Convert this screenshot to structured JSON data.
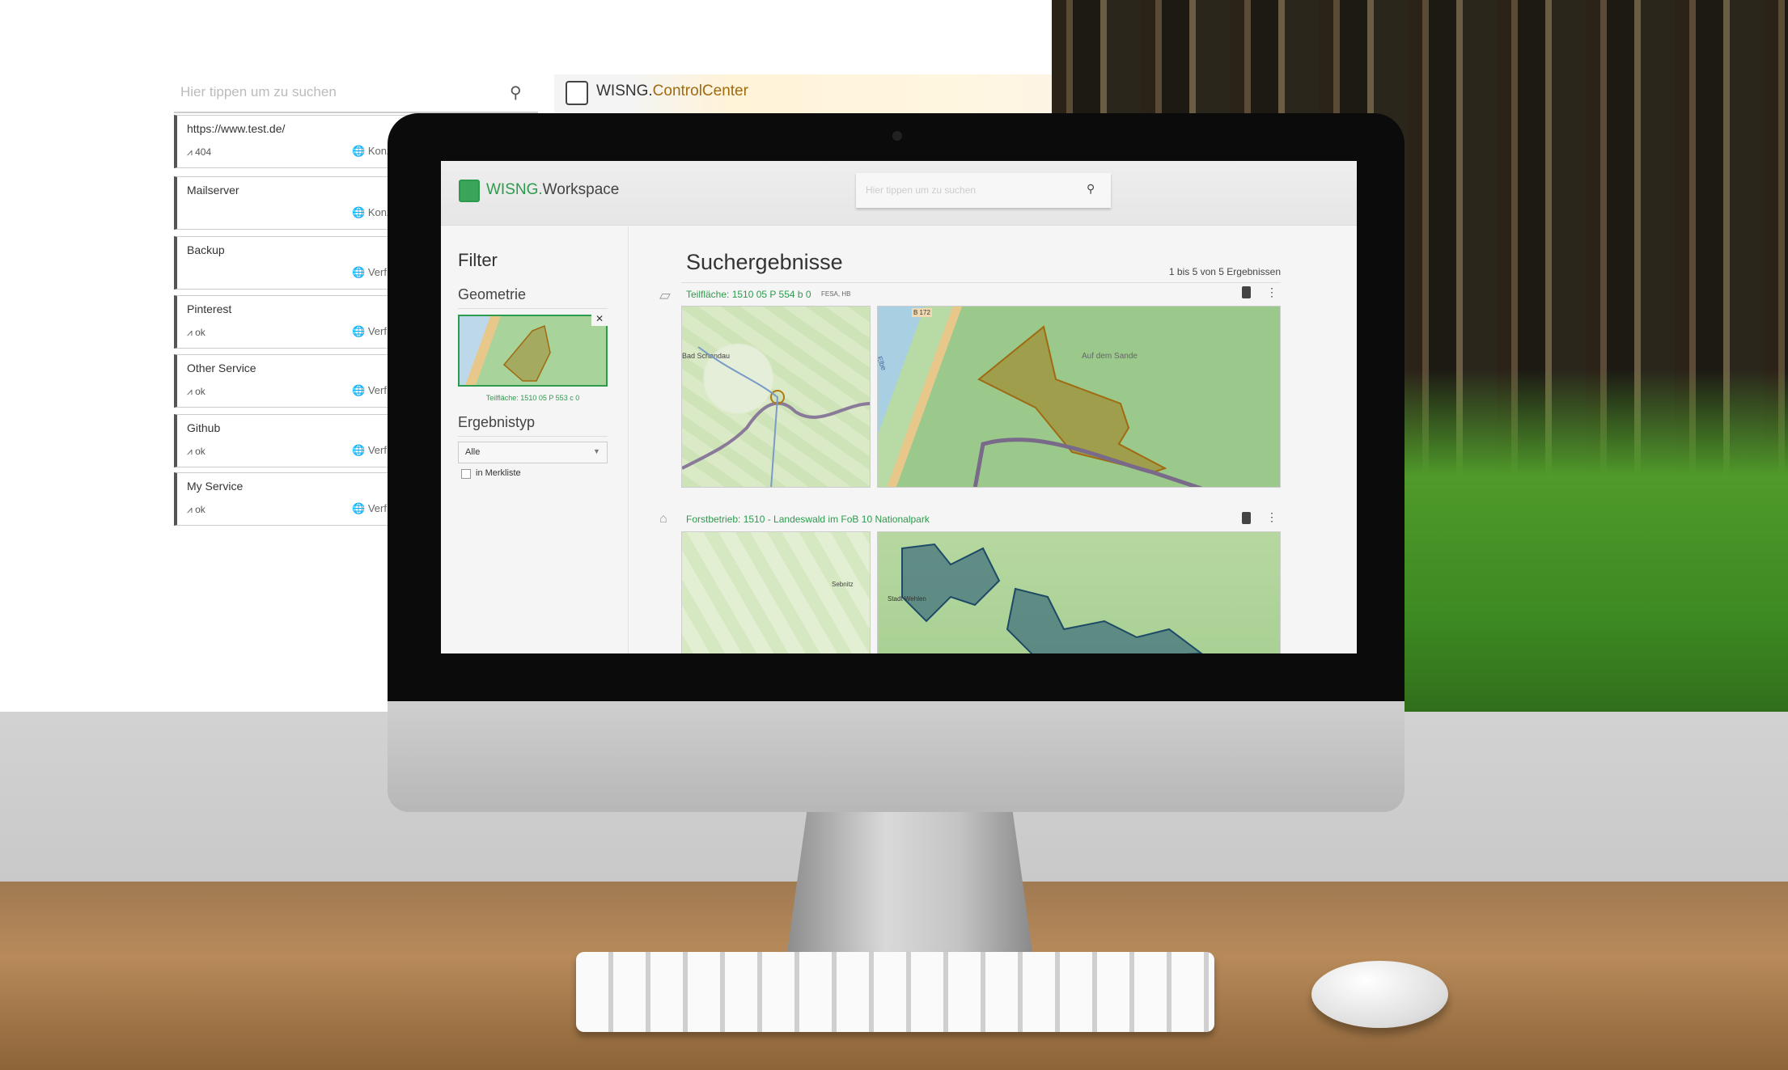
{
  "left_panel": {
    "search_placeholder": "Hier tippen um zu suchen",
    "cards": [
      {
        "title": "https://www.test.de/",
        "status": "404",
        "meta": "Konz"
      },
      {
        "title": "Mailserver",
        "status": "",
        "meta": "Konz"
      },
      {
        "title": "Backup",
        "status": "",
        "meta": "Verf"
      },
      {
        "title": "Pinterest",
        "status": "ok",
        "meta": "Verf"
      },
      {
        "title": "Other Service",
        "status": "ok",
        "meta": "Verf"
      },
      {
        "title": "Github",
        "status": "ok",
        "meta": "Verf"
      },
      {
        "title": "My Service",
        "status": "ok",
        "meta": "Verf"
      }
    ]
  },
  "controlcenter": {
    "brand_a": "WISNG.",
    "brand_b": "ControlCenter"
  },
  "workspace": {
    "brand_a": "WISNG.",
    "brand_b": "Workspace",
    "search_placeholder": "Hier tippen um zu suchen",
    "filter": {
      "title": "Filter",
      "geometry_label": "Geometrie",
      "geometry_caption": "Teilfläche: 1510 05 P 553 c 0",
      "result_type_label": "Ergebnistyp",
      "result_type_value": "Alle",
      "bookmark_label": "in Merkliste",
      "bookmark_checked": false
    },
    "results": {
      "title": "Suchergebnisse",
      "count": "1 bis 5 von 5 Ergebnissen",
      "items": [
        {
          "icon": "parcel-icon",
          "title": "Teilfläche: 1510 05 P 554 b 0",
          "tags": "FESA, HB",
          "map_labels": [
            "Bad Schandau",
            "B 172",
            "Auf dem Sande",
            "Elbe"
          ]
        },
        {
          "icon": "house-icon",
          "title": "Forstbetrieb: 1510 - Landeswald im FoB 10 Nationalpark",
          "tags": "",
          "map_labels": [
            "Sebnitz",
            "Stadt Wehlen"
          ]
        }
      ]
    }
  },
  "colors": {
    "accent": "#2e9a4e",
    "polygon": "#a07a1a"
  }
}
